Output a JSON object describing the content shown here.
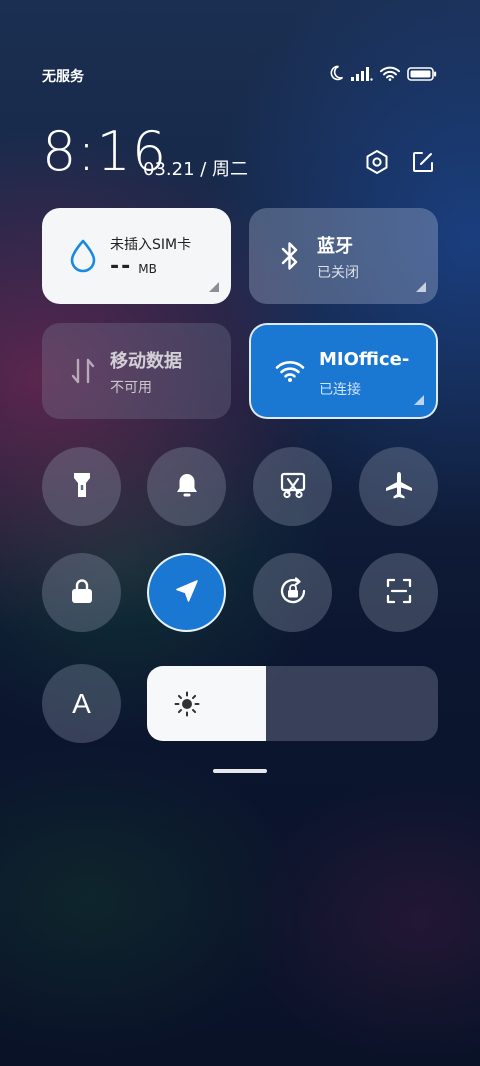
{
  "status_bar": {
    "carrier": "无服务",
    "icons": [
      "moon-icon",
      "signal-icon",
      "wifi-icon",
      "battery-icon"
    ]
  },
  "header": {
    "time": "8:16",
    "date": "03.21 / 周二",
    "icons": [
      "settings-hexagon-icon",
      "edit-icon"
    ]
  },
  "cards": {
    "data_usage": {
      "title": "未插入SIM卡",
      "value": "--",
      "unit": "MB",
      "icon": "water-drop-icon"
    },
    "bluetooth": {
      "title": "蓝牙",
      "status": "已关闭",
      "icon": "bluetooth-icon"
    },
    "mobile_data": {
      "title": "移动数据",
      "status": "不可用",
      "icon": "data-arrows-icon"
    },
    "wifi": {
      "title": "MIOffice-",
      "status": "已连接",
      "icon": "wifi-icon",
      "active": true
    }
  },
  "toggles": [
    {
      "name": "flashlight",
      "icon": "flashlight-icon",
      "active": false
    },
    {
      "name": "ringer",
      "icon": "bell-icon",
      "active": false
    },
    {
      "name": "screenshot",
      "icon": "scissors-icon",
      "active": false
    },
    {
      "name": "airplane-mode",
      "icon": "airplane-icon",
      "active": false
    },
    {
      "name": "lock-screen",
      "icon": "lock-icon",
      "active": false
    },
    {
      "name": "location",
      "icon": "location-arrow-icon",
      "active": true
    },
    {
      "name": "rotation-lock",
      "icon": "rotation-lock-icon",
      "active": false
    },
    {
      "name": "scanner",
      "icon": "scan-icon",
      "active": false
    },
    {
      "name": "auto-brightness",
      "label": "A",
      "active": false
    }
  ],
  "brightness": {
    "level": 0.41,
    "icon": "sun-icon"
  },
  "colors": {
    "accent": "#1a77d2",
    "card_light": "#f4f6f8"
  }
}
